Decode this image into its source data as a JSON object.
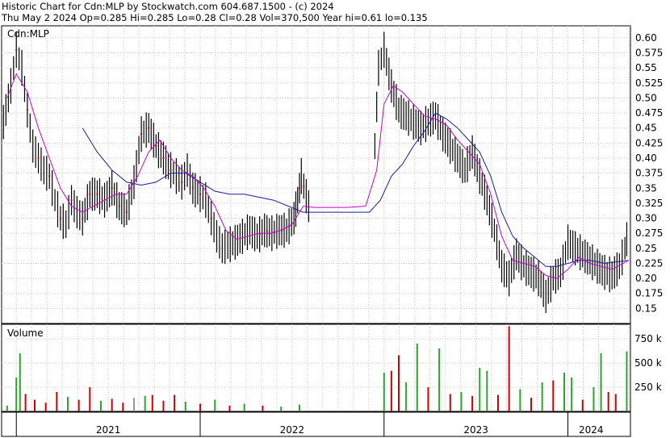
{
  "header": {
    "title": "Historic Chart for Cdn:MLP by Stockwatch.com 604.687.1500 - (c) 2024",
    "quote": "Thu May  2 2024  Op=0.285  Hi=0.285  Lo=0.28  Cl=0.28  Vol=370,500  Year hi=0.61  lo=0.135"
  },
  "chart_data": [
    {
      "type": "line",
      "title": "Cdn:MLP",
      "ylim": [
        0.125,
        0.62
      ],
      "y_ticks": [
        "0.60",
        "0.575",
        "0.55",
        "0.525",
        "0.50",
        "0.475",
        "0.45",
        "0.425",
        "0.40",
        "0.375",
        "0.35",
        "0.325",
        "0.30",
        "0.275",
        "0.25",
        "0.225",
        "0.20",
        "0.175",
        "0.15"
      ],
      "x_labels": [
        "2021",
        "2022",
        "2023",
        "2024"
      ],
      "grid": true,
      "colors": {
        "price": "#000000",
        "ma_short": "#cc00cc",
        "ma_long": "#1a1aa0",
        "down_day": "#cc0000"
      },
      "price_close": [
        [
          2020.93,
          0.46
        ],
        [
          2020.97,
          0.52
        ],
        [
          2021.0,
          0.58
        ],
        [
          2021.03,
          0.55
        ],
        [
          2021.06,
          0.48
        ],
        [
          2021.09,
          0.42
        ],
        [
          2021.12,
          0.4
        ],
        [
          2021.15,
          0.38
        ],
        [
          2021.18,
          0.37
        ],
        [
          2021.21,
          0.33
        ],
        [
          2021.24,
          0.3
        ],
        [
          2021.27,
          0.29
        ],
        [
          2021.3,
          0.33
        ],
        [
          2021.33,
          0.31
        ],
        [
          2021.36,
          0.3
        ],
        [
          2021.4,
          0.34
        ],
        [
          2021.44,
          0.34
        ],
        [
          2021.48,
          0.33
        ],
        [
          2021.52,
          0.35
        ],
        [
          2021.56,
          0.32
        ],
        [
          2021.6,
          0.31
        ],
        [
          2021.64,
          0.36
        ],
        [
          2021.68,
          0.44
        ],
        [
          2021.72,
          0.45
        ],
        [
          2021.76,
          0.42
        ],
        [
          2021.8,
          0.4
        ],
        [
          2021.84,
          0.38
        ],
        [
          2021.87,
          0.37
        ],
        [
          2021.9,
          0.36
        ],
        [
          2021.93,
          0.38
        ],
        [
          2021.96,
          0.35
        ],
        [
          2022.0,
          0.34
        ],
        [
          2022.03,
          0.33
        ],
        [
          2022.06,
          0.3
        ],
        [
          2022.09,
          0.27
        ],
        [
          2022.12,
          0.25
        ],
        [
          2022.15,
          0.255
        ],
        [
          2022.19,
          0.26
        ],
        [
          2022.23,
          0.27
        ],
        [
          2022.27,
          0.28
        ],
        [
          2022.31,
          0.27
        ],
        [
          2022.35,
          0.28
        ],
        [
          2022.39,
          0.275
        ],
        [
          2022.43,
          0.28
        ],
        [
          2022.47,
          0.28
        ],
        [
          2022.51,
          0.3
        ],
        [
          2022.53,
          0.33
        ],
        [
          2022.55,
          0.37
        ],
        [
          2022.59,
          0.32
        ],
        [
          2022.73,
          0.32
        ],
        [
          2022.86,
          0.32
        ],
        [
          2022.92,
          0.32
        ],
        [
          2022.95,
          0.42
        ],
        [
          2022.97,
          0.55
        ],
        [
          2023.0,
          0.58
        ],
        [
          2023.04,
          0.52
        ],
        [
          2023.08,
          0.48
        ],
        [
          2023.12,
          0.47
        ],
        [
          2023.16,
          0.46
        ],
        [
          2023.2,
          0.45
        ],
        [
          2023.24,
          0.46
        ],
        [
          2023.28,
          0.47
        ],
        [
          2023.32,
          0.44
        ],
        [
          2023.36,
          0.42
        ],
        [
          2023.4,
          0.4
        ],
        [
          2023.44,
          0.38
        ],
        [
          2023.48,
          0.41
        ],
        [
          2023.52,
          0.37
        ],
        [
          2023.56,
          0.33
        ],
        [
          2023.6,
          0.28
        ],
        [
          2023.64,
          0.22
        ],
        [
          2023.68,
          0.2
        ],
        [
          2023.72,
          0.24
        ],
        [
          2023.76,
          0.22
        ],
        [
          2023.8,
          0.21
        ],
        [
          2023.84,
          0.2
        ],
        [
          2023.88,
          0.17
        ],
        [
          2023.92,
          0.2
        ],
        [
          2023.96,
          0.21
        ],
        [
          2024.0,
          0.26
        ],
        [
          2024.04,
          0.25
        ],
        [
          2024.08,
          0.24
        ],
        [
          2024.12,
          0.23
        ],
        [
          2024.16,
          0.22
        ],
        [
          2024.2,
          0.21
        ],
        [
          2024.24,
          0.205
        ],
        [
          2024.28,
          0.22
        ],
        [
          2024.31,
          0.25
        ],
        [
          2024.33,
          0.28
        ]
      ],
      "ma_short": [
        [
          2020.95,
          0.5
        ],
        [
          2021.0,
          0.54
        ],
        [
          2021.06,
          0.51
        ],
        [
          2021.12,
          0.45
        ],
        [
          2021.18,
          0.4
        ],
        [
          2021.24,
          0.35
        ],
        [
          2021.3,
          0.32
        ],
        [
          2021.36,
          0.31
        ],
        [
          2021.42,
          0.32
        ],
        [
          2021.48,
          0.33
        ],
        [
          2021.54,
          0.34
        ],
        [
          2021.6,
          0.34
        ],
        [
          2021.66,
          0.37
        ],
        [
          2021.72,
          0.41
        ],
        [
          2021.78,
          0.43
        ],
        [
          2021.84,
          0.4
        ],
        [
          2021.9,
          0.38
        ],
        [
          2021.96,
          0.37
        ],
        [
          2022.02,
          0.35
        ],
        [
          2022.08,
          0.32
        ],
        [
          2022.14,
          0.28
        ],
        [
          2022.2,
          0.265
        ],
        [
          2022.26,
          0.27
        ],
        [
          2022.32,
          0.275
        ],
        [
          2022.38,
          0.275
        ],
        [
          2022.44,
          0.28
        ],
        [
          2022.5,
          0.29
        ],
        [
          2022.56,
          0.32
        ],
        [
          2022.62,
          0.318
        ],
        [
          2022.7,
          0.318
        ],
        [
          2022.8,
          0.318
        ],
        [
          2022.9,
          0.32
        ],
        [
          2022.96,
          0.38
        ],
        [
          2023.0,
          0.49
        ],
        [
          2023.05,
          0.52
        ],
        [
          2023.1,
          0.51
        ],
        [
          2023.16,
          0.49
        ],
        [
          2023.22,
          0.47
        ],
        [
          2023.28,
          0.465
        ],
        [
          2023.34,
          0.455
        ],
        [
          2023.4,
          0.43
        ],
        [
          2023.46,
          0.41
        ],
        [
          2023.52,
          0.39
        ],
        [
          2023.58,
          0.34
        ],
        [
          2023.64,
          0.27
        ],
        [
          2023.7,
          0.23
        ],
        [
          2023.76,
          0.225
        ],
        [
          2023.82,
          0.22
        ],
        [
          2023.88,
          0.205
        ],
        [
          2023.94,
          0.2
        ],
        [
          2024.0,
          0.215
        ],
        [
          2024.06,
          0.235
        ],
        [
          2024.12,
          0.225
        ],
        [
          2024.18,
          0.22
        ],
        [
          2024.24,
          0.215
        ],
        [
          2024.33,
          0.23
        ]
      ],
      "ma_long": [
        [
          2021.36,
          0.45
        ],
        [
          2021.44,
          0.41
        ],
        [
          2021.52,
          0.38
        ],
        [
          2021.6,
          0.36
        ],
        [
          2021.68,
          0.355
        ],
        [
          2021.76,
          0.36
        ],
        [
          2021.84,
          0.375
        ],
        [
          2021.92,
          0.375
        ],
        [
          2022.0,
          0.36
        ],
        [
          2022.08,
          0.345
        ],
        [
          2022.16,
          0.34
        ],
        [
          2022.24,
          0.34
        ],
        [
          2022.32,
          0.335
        ],
        [
          2022.4,
          0.33
        ],
        [
          2022.48,
          0.32
        ],
        [
          2022.56,
          0.31
        ],
        [
          2022.66,
          0.31
        ],
        [
          2022.8,
          0.31
        ],
        [
          2022.92,
          0.31
        ],
        [
          2022.98,
          0.33
        ],
        [
          2023.04,
          0.37
        ],
        [
          2023.1,
          0.39
        ],
        [
          2023.16,
          0.42
        ],
        [
          2023.22,
          0.445
        ],
        [
          2023.28,
          0.475
        ],
        [
          2023.34,
          0.465
        ],
        [
          2023.4,
          0.45
        ],
        [
          2023.46,
          0.43
        ],
        [
          2023.52,
          0.41
        ],
        [
          2023.58,
          0.37
        ],
        [
          2023.64,
          0.31
        ],
        [
          2023.7,
          0.27
        ],
        [
          2023.76,
          0.25
        ],
        [
          2023.82,
          0.235
        ],
        [
          2023.88,
          0.22
        ],
        [
          2023.94,
          0.22
        ],
        [
          2024.0,
          0.225
        ],
        [
          2024.06,
          0.23
        ],
        [
          2024.12,
          0.23
        ],
        [
          2024.2,
          0.225
        ],
        [
          2024.33,
          0.23
        ]
      ]
    },
    {
      "type": "bar",
      "title": "Volume",
      "ylim": [
        0,
        900000
      ],
      "y_ticks": [
        "750 k",
        "500 k",
        "250 k"
      ],
      "y_tick_values": [
        750000,
        500000,
        250000
      ],
      "grid": true,
      "bars": [
        [
          2020.95,
          60000,
          "up"
        ],
        [
          2021.0,
          350000,
          "up"
        ],
        [
          2021.02,
          600000,
          "up"
        ],
        [
          2021.05,
          180000,
          "down"
        ],
        [
          2021.1,
          120000,
          "down"
        ],
        [
          2021.16,
          90000,
          "down"
        ],
        [
          2021.22,
          200000,
          "down"
        ],
        [
          2021.28,
          150000,
          "up"
        ],
        [
          2021.34,
          120000,
          "down"
        ],
        [
          2021.4,
          250000,
          "down"
        ],
        [
          2021.46,
          110000,
          "up"
        ],
        [
          2021.52,
          130000,
          "down"
        ],
        [
          2021.58,
          90000,
          "down"
        ],
        [
          2021.64,
          140000,
          "gray"
        ],
        [
          2021.7,
          160000,
          "up"
        ],
        [
          2021.74,
          170000,
          "down"
        ],
        [
          2021.8,
          110000,
          "down"
        ],
        [
          2021.86,
          170000,
          "down"
        ],
        [
          2021.92,
          100000,
          "up"
        ],
        [
          2022.0,
          80000,
          "down"
        ],
        [
          2022.08,
          120000,
          "up"
        ],
        [
          2022.16,
          60000,
          "down"
        ],
        [
          2022.24,
          80000,
          "up"
        ],
        [
          2022.34,
          60000,
          "down"
        ],
        [
          2022.44,
          50000,
          "up"
        ],
        [
          2022.54,
          70000,
          "up"
        ],
        [
          2023.0,
          400000,
          "up"
        ],
        [
          2023.04,
          420000,
          "down"
        ],
        [
          2023.08,
          580000,
          "down"
        ],
        [
          2023.12,
          300000,
          "up"
        ],
        [
          2023.18,
          700000,
          "up"
        ],
        [
          2023.24,
          250000,
          "down"
        ],
        [
          2023.3,
          650000,
          "up"
        ],
        [
          2023.36,
          180000,
          "down"
        ],
        [
          2023.42,
          200000,
          "up"
        ],
        [
          2023.48,
          160000,
          "down"
        ],
        [
          2023.52,
          450000,
          "up"
        ],
        [
          2023.56,
          420000,
          "up"
        ],
        [
          2023.62,
          170000,
          "down"
        ],
        [
          2023.68,
          880000,
          "down"
        ],
        [
          2023.74,
          230000,
          "up"
        ],
        [
          2023.8,
          140000,
          "down"
        ],
        [
          2023.86,
          300000,
          "up"
        ],
        [
          2023.92,
          320000,
          "down"
        ],
        [
          2023.98,
          400000,
          "up"
        ],
        [
          2024.02,
          350000,
          "up"
        ],
        [
          2024.08,
          120000,
          "down"
        ],
        [
          2024.14,
          250000,
          "up"
        ],
        [
          2024.18,
          600000,
          "up"
        ],
        [
          2024.22,
          200000,
          "down"
        ],
        [
          2024.26,
          180000,
          "down"
        ],
        [
          2024.32,
          620000,
          "up"
        ]
      ]
    }
  ]
}
